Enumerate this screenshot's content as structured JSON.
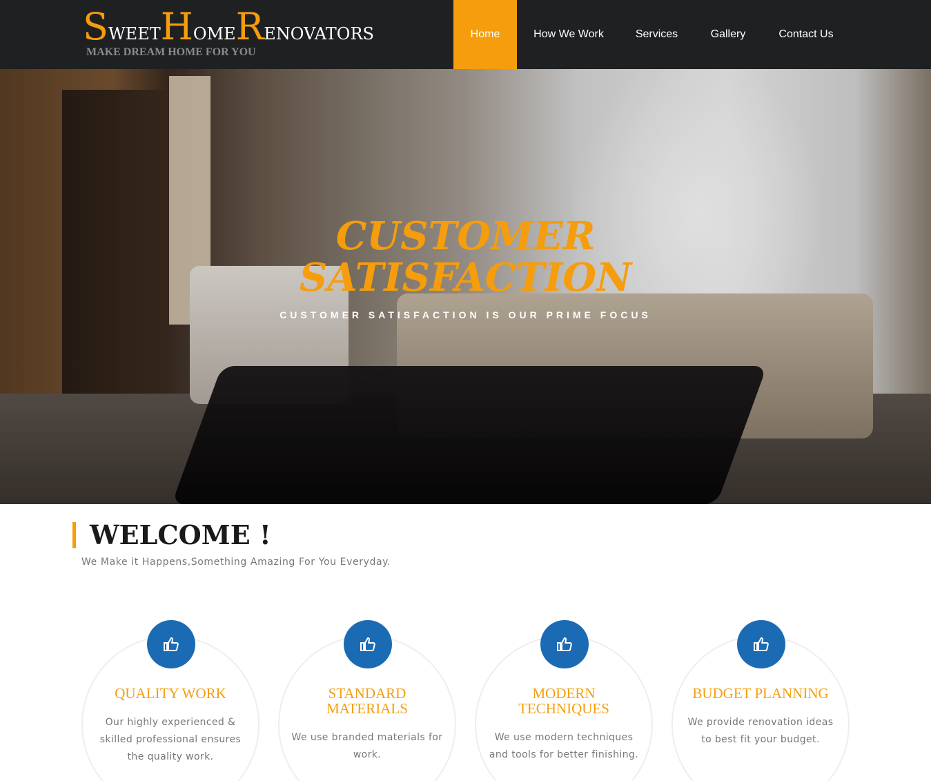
{
  "brand": {
    "title_parts": [
      {
        "cap": "S",
        "rest": "weet"
      },
      {
        "cap": "H",
        "rest": "ome"
      },
      {
        "cap": "R",
        "rest": "enovators"
      }
    ],
    "tagline": "MAKE DREAM HOME FOR YOU",
    "accent_color": "#f59d0c"
  },
  "nav": {
    "items": [
      {
        "label": "Home",
        "active": true
      },
      {
        "label": "How We Work",
        "active": false
      },
      {
        "label": "Services",
        "active": false
      },
      {
        "label": "Gallery",
        "active": false
      },
      {
        "label": "Contact Us",
        "active": false
      }
    ]
  },
  "hero": {
    "title_line1": "CUSTOMER",
    "title_line2": "SATISFACTION",
    "subtitle": "CUSTOMER SATISFACTION IS OUR PRIME FOCUS"
  },
  "welcome": {
    "title": "WELCOME !",
    "subtitle": "We Make it Happens,Something Amazing For You Everyday."
  },
  "features": [
    {
      "icon": "thumbs-up-icon",
      "title_lines": [
        "QUALITY WORK"
      ],
      "desc_lines": [
        "Our highly experienced &",
        "skilled professional ensures",
        "the quality work."
      ]
    },
    {
      "icon": "thumbs-up-icon",
      "title_lines": [
        "STANDARD",
        "MATERIALS"
      ],
      "desc_lines": [
        "We use branded materials for",
        "work."
      ]
    },
    {
      "icon": "thumbs-up-icon",
      "title_lines": [
        "MODERN",
        "TECHNIQUES"
      ],
      "desc_lines": [
        "We use modern techniques",
        "and tools for better finishing."
      ]
    },
    {
      "icon": "thumbs-up-icon",
      "title_lines": [
        "BUDGET PLANNING"
      ],
      "desc_lines": [
        "We provide renovation ideas",
        "to best fit your budget."
      ]
    }
  ],
  "colors": {
    "nav_bg": "#1f2021",
    "icon_circle": "#1b6bb4"
  }
}
